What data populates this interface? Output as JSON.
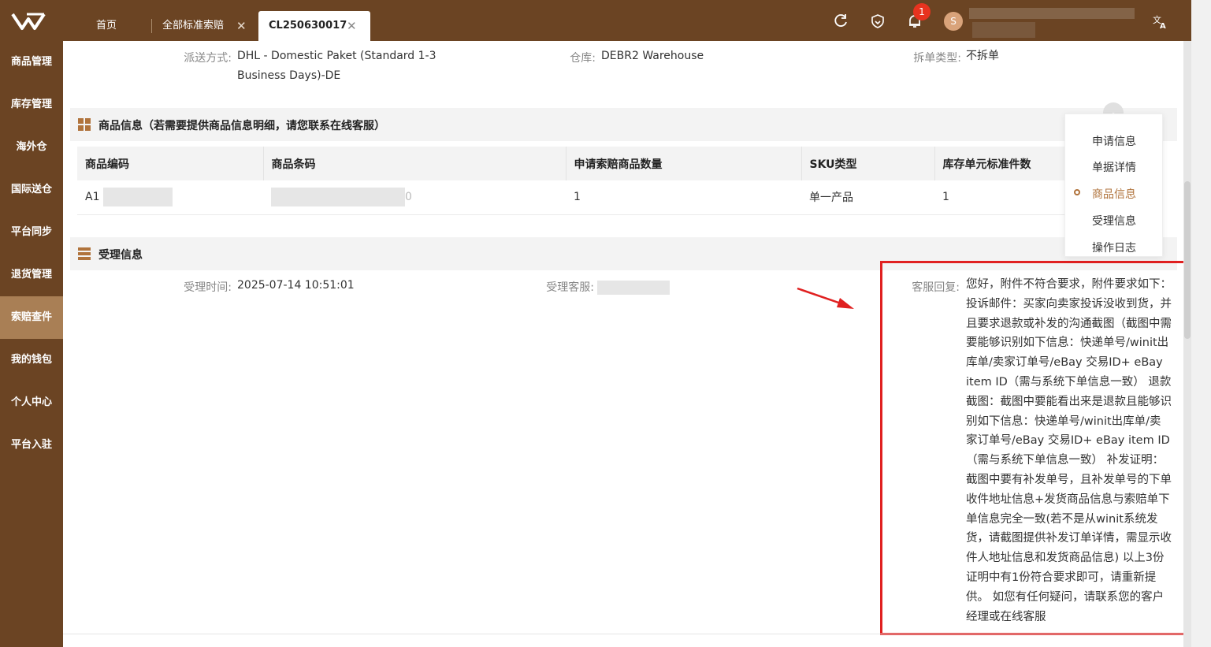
{
  "topbar": {
    "tabs": [
      {
        "label": "首页"
      },
      {
        "label": "全部标准索赔",
        "closable": true
      },
      {
        "label": "CL250630017",
        "closable": true,
        "active": true
      }
    ],
    "notification_count": "1",
    "user_initial": "S",
    "icons": [
      "refresh-icon",
      "heart-shield-icon",
      "bell-icon",
      "translate-icon"
    ]
  },
  "sidebar": {
    "items": [
      {
        "label": "商品管理"
      },
      {
        "label": "库存管理"
      },
      {
        "label": "海外仓"
      },
      {
        "label": "国际送仓"
      },
      {
        "label": "平台同步"
      },
      {
        "label": "退货管理"
      },
      {
        "label": "索赔查件",
        "active": true
      },
      {
        "label": "我的钱包"
      },
      {
        "label": "个人中心"
      },
      {
        "label": "平台入驻"
      }
    ]
  },
  "delivery": {
    "method_label": "派送方式:",
    "method_value_line1": "DHL - Domestic Paket (Standard 1-3",
    "method_value_line2": "Business Days)-DE",
    "warehouse_label": "仓库:",
    "warehouse_value": "DEBR2 Warehouse",
    "split_label": "拆单类型:",
    "split_value": "不拆单"
  },
  "goods": {
    "title": "商品信息（若需要提供商品信息明细，请您联系在线客服）",
    "columns": [
      "商品编码",
      "商品条码",
      "申请索赔商品数量",
      "SKU类型",
      "库存单元标准件数"
    ],
    "rows": [
      {
        "code_prefix": "A1",
        "barcode_suffix": "0",
        "qty": "1",
        "sku_type": "单一产品",
        "std_qty": "1"
      }
    ]
  },
  "handling": {
    "title": "受理信息",
    "time_label": "受理时间:",
    "time_value": "2025-07-14 10:51:01",
    "agent_label": "受理客服:",
    "reply_label": "客服回复:",
    "reply_text": "您好，附件不符合要求，附件要求如下： 投诉邮件：买家向卖家投诉没收到货，并且要求退款或补发的沟通截图（截图中需要能够识别如下信息：快递单号/winit出库单/卖家订单号/eBay 交易ID+ eBay item ID（需与系统下单信息一致） 退款截图：截图中要能看出来是退款且能够识别如下信息：快递单号/winit出库单/卖家订单号/eBay 交易ID+ eBay item ID（需与系统下单信息一致） 补发证明：截图中要有补发单号，且补发单号的下单收件地址信息+发货商品信息与索赔单下单信息完全一致(若不是从winit系统发货，请截图提供补发订单详情，需显示收件人地址信息和发货商品信息) 以上3份证明中有1份符合要求即可，请重新提供。 如您有任何疑问，请联系您的客户经理或在线客服"
  },
  "anchor_nav": {
    "items": [
      {
        "label": "申请信息"
      },
      {
        "label": "单据详情"
      },
      {
        "label": "商品信息",
        "active": true
      },
      {
        "label": "受理信息"
      },
      {
        "label": "操作日志"
      }
    ]
  },
  "colors": {
    "brand_brown": "#6b4423",
    "sidebar_active": "#a97f55",
    "accent": "#b0733c",
    "annotation_red": "#e02020"
  }
}
